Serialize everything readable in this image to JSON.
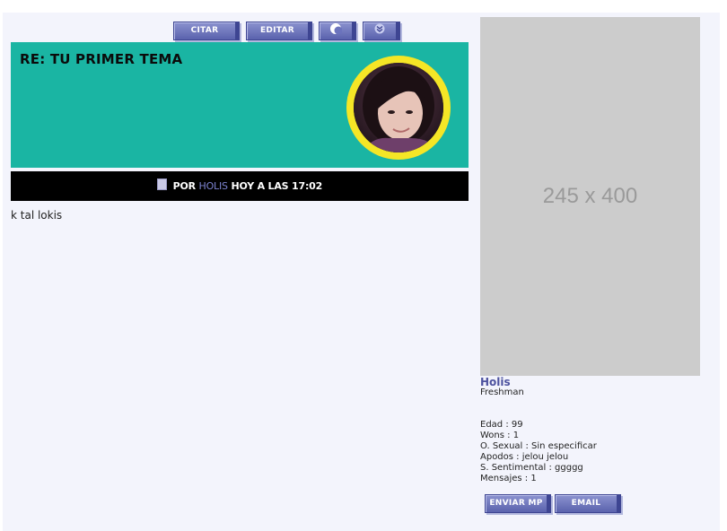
{
  "toolbar": {
    "quote_label": "CITAR",
    "edit_label": "EDITAR",
    "moderate_icon": "crescent-moon-icon",
    "menu_icon": "double-chevron-down-icon"
  },
  "post": {
    "title": "RE: TU PRIMER TEMA",
    "by_label": "POR",
    "author": "HOLIS",
    "time": "HOY A LAS 17:02",
    "body": "k tal lokis"
  },
  "sidebar": {
    "image_placeholder": "245 x 400",
    "username": "Holis",
    "rank": "Freshman",
    "details": [
      "Edad : 99",
      "Wons : 1",
      "O. Sexual : Sin especificar",
      "Apodos : jelou jelou",
      "S. Sentimental : ggggg",
      "Mensajes : 1"
    ],
    "pm_label": "ENVIAR MP",
    "email_label": "EMAIL"
  },
  "colors": {
    "banner": "#1ab5a3",
    "avatar_ring": "#f5e626",
    "button": "#6b73bd",
    "author_link": "#7c83d0",
    "username": "#4d529f"
  }
}
